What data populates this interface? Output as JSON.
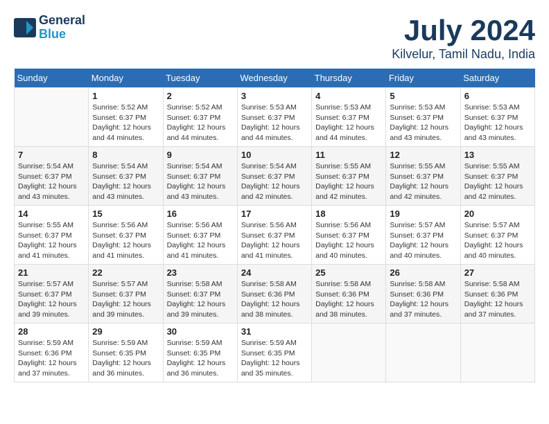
{
  "header": {
    "logo_line1": "General",
    "logo_line2": "Blue",
    "month": "July 2024",
    "location": "Kilvelur, Tamil Nadu, India"
  },
  "weekdays": [
    "Sunday",
    "Monday",
    "Tuesday",
    "Wednesday",
    "Thursday",
    "Friday",
    "Saturday"
  ],
  "weeks": [
    [
      {
        "day": "",
        "empty": true
      },
      {
        "day": "1",
        "sunrise": "Sunrise: 5:52 AM",
        "sunset": "Sunset: 6:37 PM",
        "daylight": "Daylight: 12 hours and 44 minutes."
      },
      {
        "day": "2",
        "sunrise": "Sunrise: 5:52 AM",
        "sunset": "Sunset: 6:37 PM",
        "daylight": "Daylight: 12 hours and 44 minutes."
      },
      {
        "day": "3",
        "sunrise": "Sunrise: 5:53 AM",
        "sunset": "Sunset: 6:37 PM",
        "daylight": "Daylight: 12 hours and 44 minutes."
      },
      {
        "day": "4",
        "sunrise": "Sunrise: 5:53 AM",
        "sunset": "Sunset: 6:37 PM",
        "daylight": "Daylight: 12 hours and 44 minutes."
      },
      {
        "day": "5",
        "sunrise": "Sunrise: 5:53 AM",
        "sunset": "Sunset: 6:37 PM",
        "daylight": "Daylight: 12 hours and 43 minutes."
      },
      {
        "day": "6",
        "sunrise": "Sunrise: 5:53 AM",
        "sunset": "Sunset: 6:37 PM",
        "daylight": "Daylight: 12 hours and 43 minutes."
      }
    ],
    [
      {
        "day": "7",
        "sunrise": "Sunrise: 5:54 AM",
        "sunset": "Sunset: 6:37 PM",
        "daylight": "Daylight: 12 hours and 43 minutes."
      },
      {
        "day": "8",
        "sunrise": "Sunrise: 5:54 AM",
        "sunset": "Sunset: 6:37 PM",
        "daylight": "Daylight: 12 hours and 43 minutes."
      },
      {
        "day": "9",
        "sunrise": "Sunrise: 5:54 AM",
        "sunset": "Sunset: 6:37 PM",
        "daylight": "Daylight: 12 hours and 43 minutes."
      },
      {
        "day": "10",
        "sunrise": "Sunrise: 5:54 AM",
        "sunset": "Sunset: 6:37 PM",
        "daylight": "Daylight: 12 hours and 42 minutes."
      },
      {
        "day": "11",
        "sunrise": "Sunrise: 5:55 AM",
        "sunset": "Sunset: 6:37 PM",
        "daylight": "Daylight: 12 hours and 42 minutes."
      },
      {
        "day": "12",
        "sunrise": "Sunrise: 5:55 AM",
        "sunset": "Sunset: 6:37 PM",
        "daylight": "Daylight: 12 hours and 42 minutes."
      },
      {
        "day": "13",
        "sunrise": "Sunrise: 5:55 AM",
        "sunset": "Sunset: 6:37 PM",
        "daylight": "Daylight: 12 hours and 42 minutes."
      }
    ],
    [
      {
        "day": "14",
        "sunrise": "Sunrise: 5:55 AM",
        "sunset": "Sunset: 6:37 PM",
        "daylight": "Daylight: 12 hours and 41 minutes."
      },
      {
        "day": "15",
        "sunrise": "Sunrise: 5:56 AM",
        "sunset": "Sunset: 6:37 PM",
        "daylight": "Daylight: 12 hours and 41 minutes."
      },
      {
        "day": "16",
        "sunrise": "Sunrise: 5:56 AM",
        "sunset": "Sunset: 6:37 PM",
        "daylight": "Daylight: 12 hours and 41 minutes."
      },
      {
        "day": "17",
        "sunrise": "Sunrise: 5:56 AM",
        "sunset": "Sunset: 6:37 PM",
        "daylight": "Daylight: 12 hours and 41 minutes."
      },
      {
        "day": "18",
        "sunrise": "Sunrise: 5:56 AM",
        "sunset": "Sunset: 6:37 PM",
        "daylight": "Daylight: 12 hours and 40 minutes."
      },
      {
        "day": "19",
        "sunrise": "Sunrise: 5:57 AM",
        "sunset": "Sunset: 6:37 PM",
        "daylight": "Daylight: 12 hours and 40 minutes."
      },
      {
        "day": "20",
        "sunrise": "Sunrise: 5:57 AM",
        "sunset": "Sunset: 6:37 PM",
        "daylight": "Daylight: 12 hours and 40 minutes."
      }
    ],
    [
      {
        "day": "21",
        "sunrise": "Sunrise: 5:57 AM",
        "sunset": "Sunset: 6:37 PM",
        "daylight": "Daylight: 12 hours and 39 minutes."
      },
      {
        "day": "22",
        "sunrise": "Sunrise: 5:57 AM",
        "sunset": "Sunset: 6:37 PM",
        "daylight": "Daylight: 12 hours and 39 minutes."
      },
      {
        "day": "23",
        "sunrise": "Sunrise: 5:58 AM",
        "sunset": "Sunset: 6:37 PM",
        "daylight": "Daylight: 12 hours and 39 minutes."
      },
      {
        "day": "24",
        "sunrise": "Sunrise: 5:58 AM",
        "sunset": "Sunset: 6:36 PM",
        "daylight": "Daylight: 12 hours and 38 minutes."
      },
      {
        "day": "25",
        "sunrise": "Sunrise: 5:58 AM",
        "sunset": "Sunset: 6:36 PM",
        "daylight": "Daylight: 12 hours and 38 minutes."
      },
      {
        "day": "26",
        "sunrise": "Sunrise: 5:58 AM",
        "sunset": "Sunset: 6:36 PM",
        "daylight": "Daylight: 12 hours and 37 minutes."
      },
      {
        "day": "27",
        "sunrise": "Sunrise: 5:58 AM",
        "sunset": "Sunset: 6:36 PM",
        "daylight": "Daylight: 12 hours and 37 minutes."
      }
    ],
    [
      {
        "day": "28",
        "sunrise": "Sunrise: 5:59 AM",
        "sunset": "Sunset: 6:36 PM",
        "daylight": "Daylight: 12 hours and 37 minutes."
      },
      {
        "day": "29",
        "sunrise": "Sunrise: 5:59 AM",
        "sunset": "Sunset: 6:35 PM",
        "daylight": "Daylight: 12 hours and 36 minutes."
      },
      {
        "day": "30",
        "sunrise": "Sunrise: 5:59 AM",
        "sunset": "Sunset: 6:35 PM",
        "daylight": "Daylight: 12 hours and 36 minutes."
      },
      {
        "day": "31",
        "sunrise": "Sunrise: 5:59 AM",
        "sunset": "Sunset: 6:35 PM",
        "daylight": "Daylight: 12 hours and 35 minutes."
      },
      {
        "day": "",
        "empty": true
      },
      {
        "day": "",
        "empty": true
      },
      {
        "day": "",
        "empty": true
      }
    ]
  ]
}
